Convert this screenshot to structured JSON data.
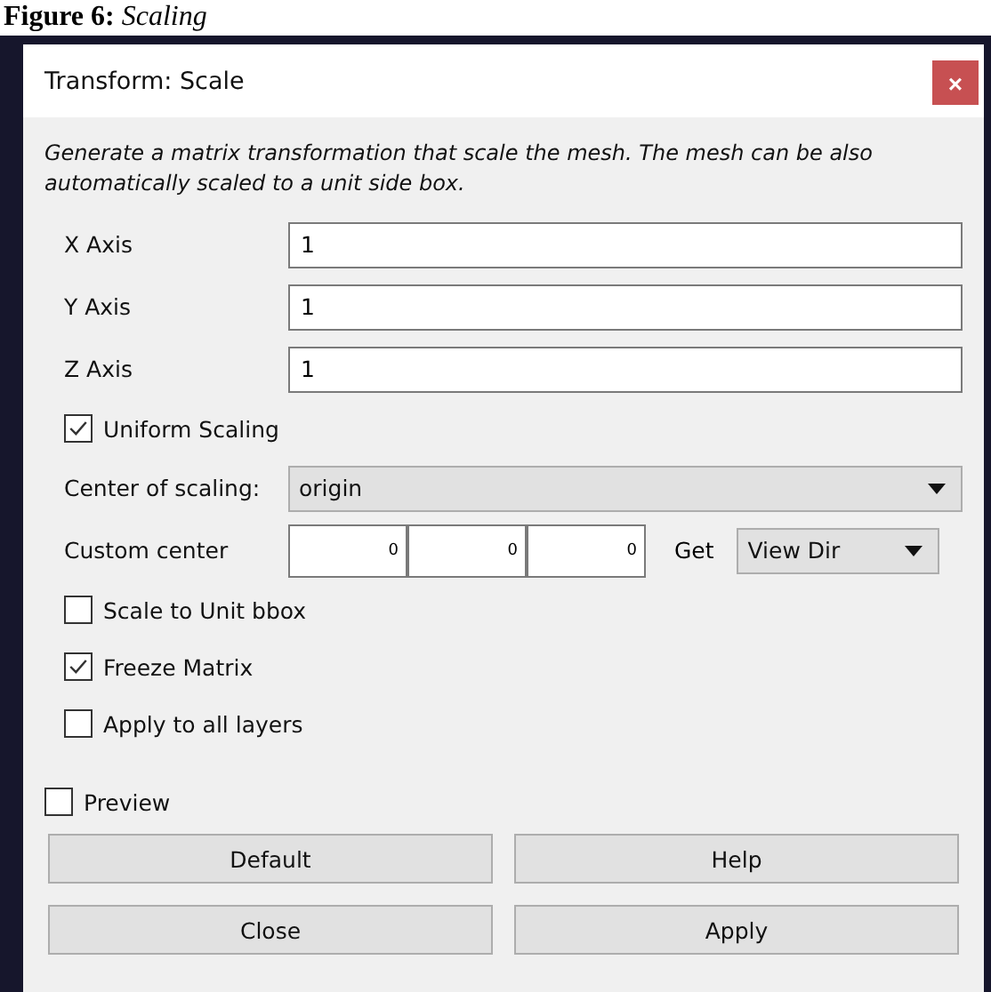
{
  "caption": "**Figure 6:** *Scaling*",
  "window": {
    "title": "Transform: Scale",
    "close": "×"
  },
  "description": "Generate a matrix transformation that scale the mesh. The mesh can be also automatically scaled to a unit side box.",
  "fields": [
    {
      "kind": "text",
      "label": "X Axis",
      "value": "1"
    },
    {
      "kind": "text",
      "label": "Y Axis",
      "value": "1"
    },
    {
      "kind": "text",
      "label": "Z Axis",
      "value": "1"
    },
    {
      "kind": "checkbox",
      "label": "Uniform Scaling",
      "checked": true
    },
    {
      "kind": "combo",
      "label": "Center of scaling:",
      "value": "origin"
    },
    {
      "kind": "point",
      "label": "Custom center",
      "values": [
        "0",
        "0",
        "0"
      ],
      "get_label": "Get",
      "get_value": "View Dir"
    },
    {
      "kind": "checkbox",
      "label": "Scale to Unit bbox",
      "checked": false
    },
    {
      "kind": "checkbox",
      "label": "Freeze Matrix",
      "checked": true
    },
    {
      "kind": "checkbox",
      "label": "Apply to all layers",
      "checked": false
    }
  ],
  "preview": {
    "label": "Preview",
    "checked": false
  },
  "buttons": [
    "Default",
    "Help",
    "Close",
    "Apply"
  ]
}
